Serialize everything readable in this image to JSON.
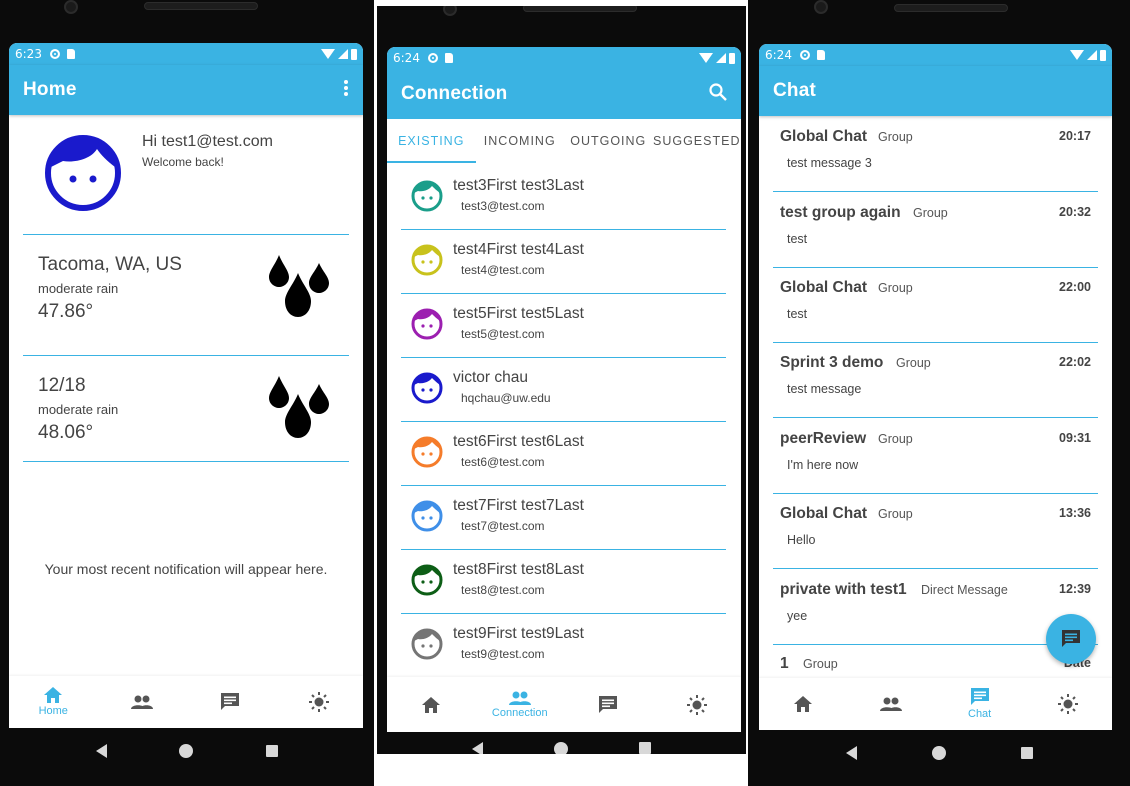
{
  "colors": {
    "primary": "#3ab3e3",
    "divider": "#3ab3e3",
    "text": "#444444"
  },
  "home": {
    "status": {
      "time": "6:23"
    },
    "appbar": {
      "title": "Home",
      "menu_icon": "more-vert-icon"
    },
    "profile": {
      "greeting": "Hi test1@test.com",
      "welcome": "Welcome back!"
    },
    "weather": [
      {
        "location": "Tacoma, WA, US",
        "description": "moderate rain",
        "temperature": "47.86°",
        "icon": "rain-drops-icon"
      },
      {
        "location": "12/18",
        "description": "moderate rain",
        "temperature": "48.06°",
        "icon": "rain-drops-icon"
      }
    ],
    "notification": "Your most recent notification will appear here.",
    "nav": {
      "home_label": "Home",
      "active": "home"
    }
  },
  "connection": {
    "status": {
      "time": "6:24"
    },
    "appbar": {
      "title": "Connection",
      "search_icon": "search-icon"
    },
    "tabs": [
      "EXISTING",
      "INCOMING",
      "OUTGOING",
      "SUGGESTED"
    ],
    "active_tab": 0,
    "contacts": [
      {
        "name": "test3First  test3Last",
        "email": "test3@test.com",
        "color": "#1a9e8a"
      },
      {
        "name": "test4First  test4Last",
        "email": "test4@test.com",
        "color": "#c8c21c"
      },
      {
        "name": "test5First  test5Last",
        "email": "test5@test.com",
        "color": "#9c1fb0"
      },
      {
        "name": "victor  chau",
        "email": "hqchau@uw.edu",
        "color": "#1a1acc"
      },
      {
        "name": "test6First  test6Last",
        "email": "test6@test.com",
        "color": "#f57c2a"
      },
      {
        "name": "test7First  test7Last",
        "email": "test7@test.com",
        "color": "#3f8fe8"
      },
      {
        "name": "test8First  test8Last",
        "email": "test8@test.com",
        "color": "#0d5e16"
      },
      {
        "name": "test9First  test9Last",
        "email": "test9@test.com",
        "color": "#757575"
      }
    ],
    "nav": {
      "connection_label": "Connection",
      "active": "connection"
    }
  },
  "chat": {
    "status": {
      "time": "6:24"
    },
    "appbar": {
      "title": "Chat"
    },
    "chats": [
      {
        "name": "Global Chat",
        "type": "Group",
        "time": "20:17",
        "message": "test message 3"
      },
      {
        "name": "test group again",
        "type": "Group",
        "time": "20:32",
        "message": "test"
      },
      {
        "name": "Global Chat",
        "type": "Group",
        "time": "22:00",
        "message": "test"
      },
      {
        "name": "Sprint 3 demo",
        "type": "Group",
        "time": "22:02",
        "message": "test message"
      },
      {
        "name": "peerReview",
        "type": "Group",
        "time": "09:31",
        "message": "I'm here now"
      },
      {
        "name": "Global Chat",
        "type": "Group",
        "time": "13:36",
        "message": "Hello"
      },
      {
        "name": "private with test1",
        "type": "Direct Message",
        "time": "12:39",
        "message": "yee"
      },
      {
        "name": "1",
        "type": "Group",
        "time": "Date",
        "message": ""
      }
    ],
    "fab_icon": "chat-bubble-icon",
    "nav": {
      "chat_label": "Chat",
      "active": "chat"
    }
  }
}
